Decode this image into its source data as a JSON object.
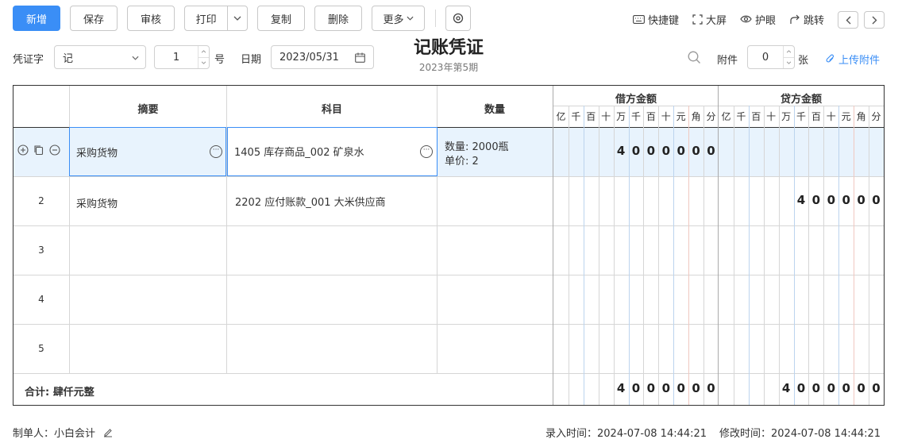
{
  "toolbar": {
    "new": "新增",
    "save": "保存",
    "audit": "审核",
    "print": "打印",
    "copy": "复制",
    "delete": "删除",
    "more": "更多"
  },
  "tools": {
    "shortcut": "快捷键",
    "fullscreen": "大屏",
    "eye": "护眼",
    "jump": "跳转"
  },
  "voucher": {
    "word_label": "凭证字",
    "word_value": "记",
    "number_value": "1",
    "number_suffix": "号",
    "date_label": "日期",
    "date_value": "2023/05/31",
    "title": "记账凭证",
    "period": "2023年第5期",
    "attach_label": "附件",
    "attach_value": "0",
    "attach_suffix": "张",
    "upload": "上传附件"
  },
  "table": {
    "headers": {
      "summary": "摘要",
      "subject": "科目",
      "quantity": "数量",
      "debit": "借方金额",
      "credit": "贷方金额"
    },
    "digit_headers": [
      "亿",
      "千",
      "百",
      "十",
      "万",
      "千",
      "百",
      "十",
      "元",
      "角",
      "分"
    ],
    "rows": [
      {
        "num": "",
        "summary": "采购货物",
        "subject": "1405 库存商品_002 矿泉水",
        "qty_line1": "数量:  2000瓶",
        "qty_line2": "单价:  2",
        "debit": [
          "",
          "",
          "",
          "",
          "4",
          "0",
          "0",
          "0",
          "0",
          "0",
          "0"
        ],
        "credit": [
          "",
          "",
          "",
          "",
          "",
          "",
          "",
          "",
          "",
          "",
          ""
        ]
      },
      {
        "num": "2",
        "summary": "采购货物",
        "subject": "2202 应付账款_001 大米供应商",
        "qty_line1": "",
        "qty_line2": "",
        "debit": [
          "",
          "",
          "",
          "",
          "",
          "",
          "",
          "",
          "",
          "",
          ""
        ],
        "credit": [
          "",
          "",
          "",
          "",
          "",
          "4",
          "0",
          "0",
          "0",
          "0",
          "0"
        ]
      },
      {
        "num": "3",
        "summary": "",
        "subject": "",
        "qty_line1": "",
        "qty_line2": "",
        "debit": [
          "",
          "",
          "",
          "",
          "",
          "",
          "",
          "",
          "",
          "",
          ""
        ],
        "credit": [
          "",
          "",
          "",
          "",
          "",
          "",
          "",
          "",
          "",
          "",
          ""
        ]
      },
      {
        "num": "4",
        "summary": "",
        "subject": "",
        "qty_line1": "",
        "qty_line2": "",
        "debit": [
          "",
          "",
          "",
          "",
          "",
          "",
          "",
          "",
          "",
          "",
          ""
        ],
        "credit": [
          "",
          "",
          "",
          "",
          "",
          "",
          "",
          "",
          "",
          "",
          ""
        ]
      },
      {
        "num": "5",
        "summary": "",
        "subject": "",
        "qty_line1": "",
        "qty_line2": "",
        "debit": [
          "",
          "",
          "",
          "",
          "",
          "",
          "",
          "",
          "",
          "",
          ""
        ],
        "credit": [
          "",
          "",
          "",
          "",
          "",
          "",
          "",
          "",
          "",
          "",
          ""
        ]
      }
    ],
    "total_label": "合计: 肆仟元整",
    "total_debit": [
      "",
      "",
      "",
      "",
      "4",
      "0",
      "0",
      "0",
      "0",
      "0",
      "0"
    ],
    "total_credit": [
      "",
      "",
      "",
      "",
      "4",
      "0",
      "0",
      "0",
      "0",
      "0",
      "0"
    ]
  },
  "footer": {
    "maker": "制单人：小白会计",
    "entry_time": "录入时间：2024-07-08 14:44:21",
    "modify_time": "修改时间：2024-07-08 14:44:21"
  },
  "colors": {
    "primary": "#3a8ef6",
    "selected_row": "#e8f3fd",
    "link": "#3a8ef6"
  }
}
